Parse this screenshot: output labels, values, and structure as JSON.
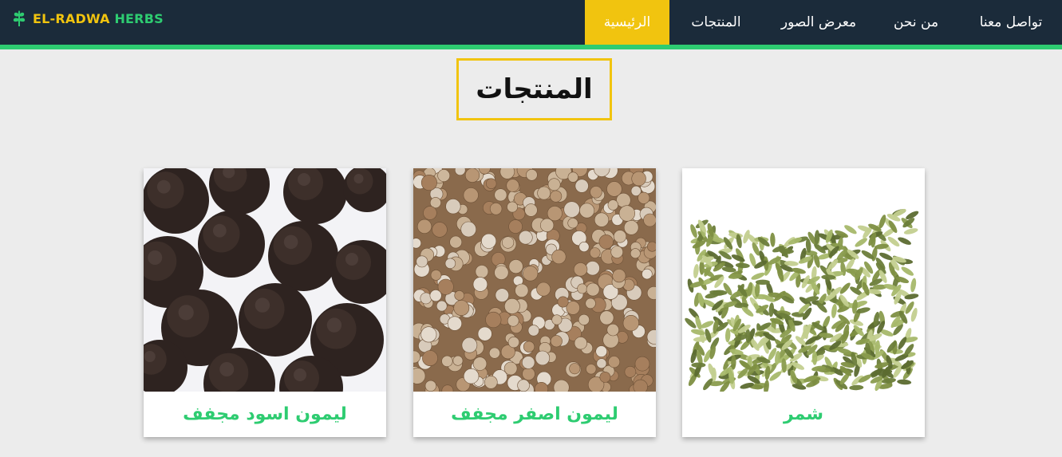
{
  "brand": {
    "name_part1": "EL-RADWA",
    "name_part2": "HERBS",
    "icon": "leaf-icon",
    "color_part1": "#f1c40f",
    "color_part2": "#2ecc71"
  },
  "nav": {
    "items": [
      {
        "label": "تواصل معنا",
        "active": false
      },
      {
        "label": "من نحن",
        "active": false
      },
      {
        "label": "معرض الصور",
        "active": false
      },
      {
        "label": "المنتجات",
        "active": false
      },
      {
        "label": "الرئيسية",
        "active": true
      }
    ]
  },
  "section": {
    "title": "المنتجات"
  },
  "products": [
    {
      "name": "شمر",
      "image": "fennel-seeds-image"
    },
    {
      "name": "ليمون اصفر مجفف",
      "image": "dried-yellow-lemon-image"
    },
    {
      "name": "ليمون اسود مجفف",
      "image": "dried-black-lemon-image"
    }
  ],
  "colors": {
    "navbar_bg": "#1b2b3a",
    "accent_green": "#2ecc71",
    "accent_yellow": "#f1c40f",
    "page_bg": "#ececec"
  }
}
